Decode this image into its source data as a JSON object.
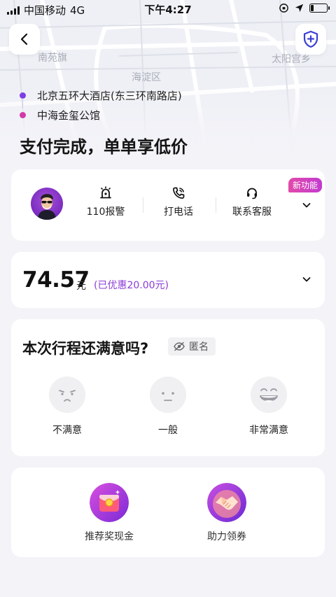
{
  "status_bar": {
    "carrier": "中国移动",
    "network": "4G",
    "time": "下午4:27",
    "battery_level": 0.2
  },
  "map": {
    "labels": [
      "南苑旗",
      "海淀区",
      "太阳宫乡"
    ]
  },
  "header": {
    "back_icon": "chevron-left-icon",
    "safety_icon": "shield-plus-icon"
  },
  "route": {
    "origin": "北京五环大酒店(东三环南路店)",
    "destination": "中海金玺公馆",
    "origin_color": "#7b3fe4",
    "destination_color": "#d23aa6"
  },
  "headline": "支付完成，单单享低价",
  "contact_card": {
    "new_badge": "新功能",
    "actions": [
      {
        "label": "110报警",
        "icon": "alarm-icon"
      },
      {
        "label": "打电话",
        "icon": "phone-icon"
      },
      {
        "label": "联系客服",
        "icon": "headset-icon"
      }
    ]
  },
  "price_card": {
    "amount": "74.57",
    "unit": "元",
    "discount": "(已优惠20.00元)"
  },
  "rating_card": {
    "title": "本次行程还满意吗?",
    "anonymous_label": "匿名",
    "options": [
      {
        "label": "不满意",
        "icon": "unhappy-face-icon"
      },
      {
        "label": "一般",
        "icon": "neutral-face-icon"
      },
      {
        "label": "非常满意",
        "icon": "happy-face-icon"
      }
    ]
  },
  "promo_card": {
    "items": [
      {
        "label": "推荐奖现金",
        "icon": "red-envelope-icon"
      },
      {
        "label": "助力领券",
        "icon": "handshake-icon"
      }
    ]
  },
  "colors": {
    "accent": "#7b2fd0",
    "discount": "#8b3ad6",
    "badge": "#d43ab8"
  }
}
